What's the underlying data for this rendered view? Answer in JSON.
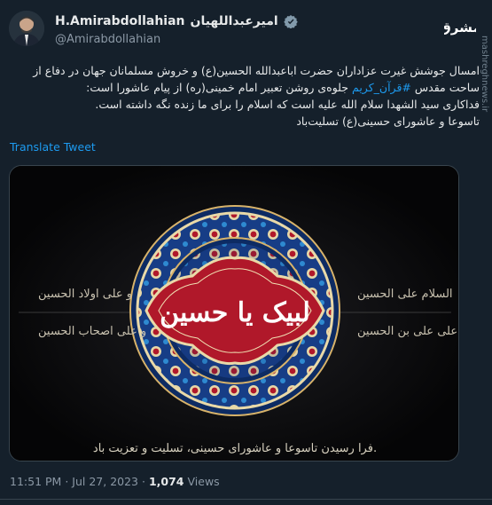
{
  "author": {
    "display_name_latin": "H.Amirabdollahian",
    "display_name_persian": "امیرعبداللهیان",
    "handle": "@Amirabdollahian",
    "verified": true
  },
  "icons": {
    "verified": "verified-badge-icon",
    "logo": "mashregh-logo-icon"
  },
  "site": {
    "logo_text": "مشرق",
    "watermark": "mashreghnews.ir"
  },
  "tweet": {
    "lines": [
      "امسال جوشش غیرت عزاداران حضرت اباعبدالله الحسین(ع) و خروش مسلمانان جهان در دفاع از",
      "ساحت مقدس",
      "جلوه‌ی روشن تعبیر امام خمینی(ره) از پیام عاشورا است:",
      "فداکاری سید الشهدا سلام الله علیه است که اسلام را برای ما زنده نگه داشته است.",
      "تاسوعا و عاشورای حسینی(ع) تسلیت‌باد"
    ],
    "hashtag": "#قرآن_کریم"
  },
  "translate_label": "Translate Tweet",
  "media": {
    "center_text": "لبیک یا حسین",
    "left_line_1": "السلام علی الحسین",
    "left_line_2": "و علی علی بن الحسین",
    "right_line_1": "و علی اولاد الحسین",
    "right_line_2": "و علی اصحاب الحسین",
    "bottom_text": "فرا رسیدن تاسوعا و عاشورای حسینی، تسلیت و تعزیت باد."
  },
  "meta": {
    "time": "11:51 PM",
    "sep": "·",
    "date": "Jul 27, 2023",
    "views_count": "1,074",
    "views_label": "Views"
  },
  "colors": {
    "background": "#15202b",
    "accent": "#1d9bf0",
    "border": "#38444d",
    "ornament_blue": "#1f4fa3",
    "ornament_red": "#b0182a",
    "ornament_gold": "#d8b36a"
  }
}
